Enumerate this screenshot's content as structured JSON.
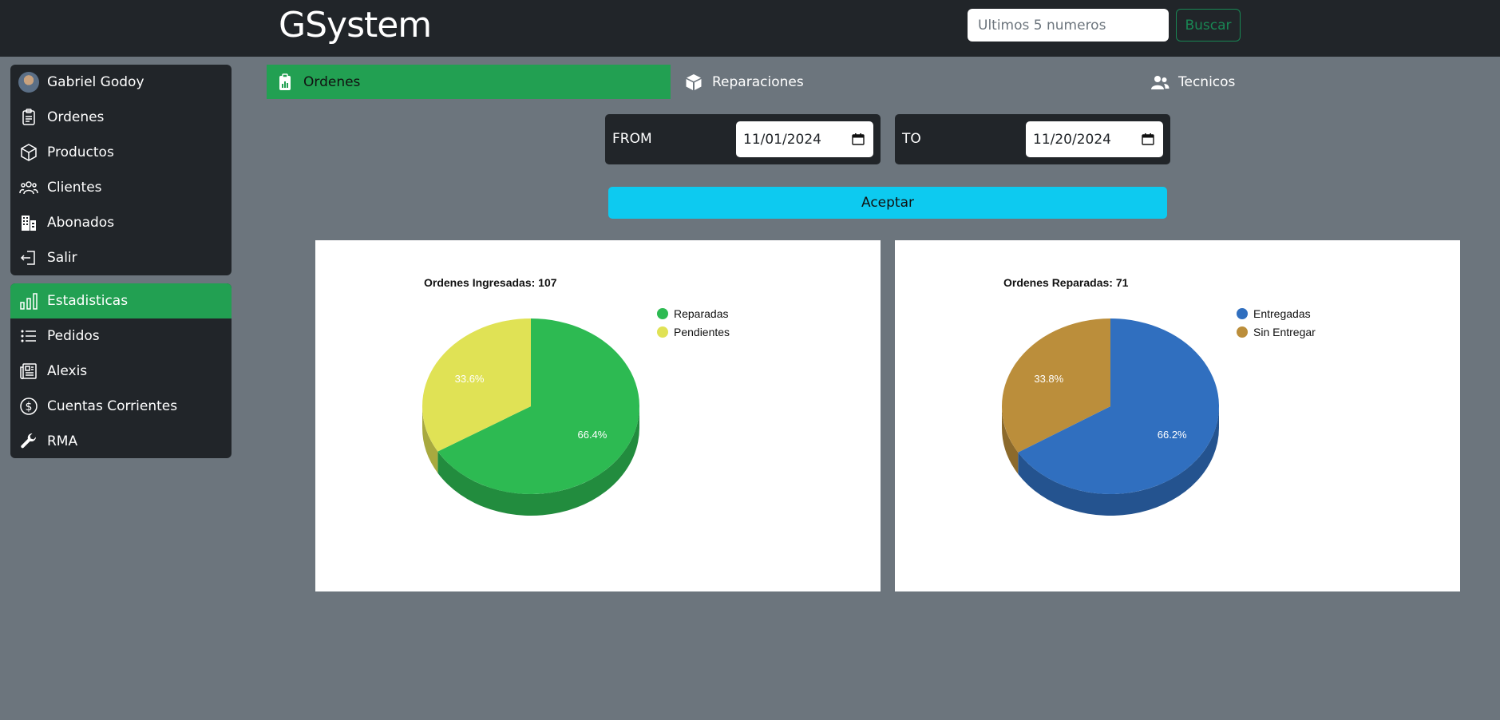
{
  "header": {
    "brand": "GSystem",
    "search": {
      "placeholder": "Ultimos 5 numeros",
      "value": ""
    },
    "search_button": "Buscar"
  },
  "sidebar": {
    "group1": [
      {
        "label": "Gabriel Godoy",
        "icon": "avatar"
      },
      {
        "label": "Ordenes",
        "icon": "clipboard-icon"
      },
      {
        "label": "Productos",
        "icon": "box-icon"
      },
      {
        "label": "Clientes",
        "icon": "people-icon"
      },
      {
        "label": "Abonados",
        "icon": "building-icon"
      },
      {
        "label": "Salir",
        "icon": "exit-icon"
      }
    ],
    "group2": [
      {
        "label": "Estadisticas",
        "icon": "bar-chart-icon",
        "active": true
      },
      {
        "label": "Pedidos",
        "icon": "list-icon"
      },
      {
        "label": "Alexis",
        "icon": "newspaper-icon"
      },
      {
        "label": "Cuentas Corrientes",
        "icon": "currency-dollar-icon"
      },
      {
        "label": "RMA",
        "icon": "wrench-icon"
      }
    ]
  },
  "tabs": [
    {
      "label": "Ordenes",
      "icon": "clipboard-data-icon",
      "active": true
    },
    {
      "label": "Reparaciones",
      "icon": "box-seam-icon"
    },
    {
      "label": "Tecnicos",
      "icon": "people-fill-icon"
    }
  ],
  "filters": {
    "from_label": "FROM",
    "from_value": "11/01/2024",
    "to_label": "TO",
    "to_value": "11/20/2024",
    "accept_button": "Aceptar"
  },
  "chart_data": [
    {
      "type": "pie",
      "title": "Ordenes Ingresadas: 107",
      "legend_position": "top-right",
      "series": [
        {
          "name": "Reparadas",
          "percent": 66.4,
          "label": "66.4%",
          "color": "#2dba52",
          "dark": "#228c3e"
        },
        {
          "name": "Pendientes",
          "percent": 33.6,
          "label": "33.6%",
          "color": "#e0e255",
          "dark": "#a8a93f"
        }
      ]
    },
    {
      "type": "pie",
      "title": "Ordenes Reparadas: 71",
      "legend_position": "top-right",
      "series": [
        {
          "name": "Entregadas",
          "percent": 66.2,
          "label": "66.2%",
          "color": "#306fbf",
          "dark": "#24538f"
        },
        {
          "name": "Sin Entregar",
          "percent": 33.8,
          "label": "33.8%",
          "color": "#bb8e3b",
          "dark": "#8c6a2c"
        }
      ]
    }
  ],
  "colors": {
    "navbar": "#212529",
    "page_bg": "#6c757d",
    "active_green": "#22a052",
    "accept_cyan": "#0dcaf0"
  }
}
